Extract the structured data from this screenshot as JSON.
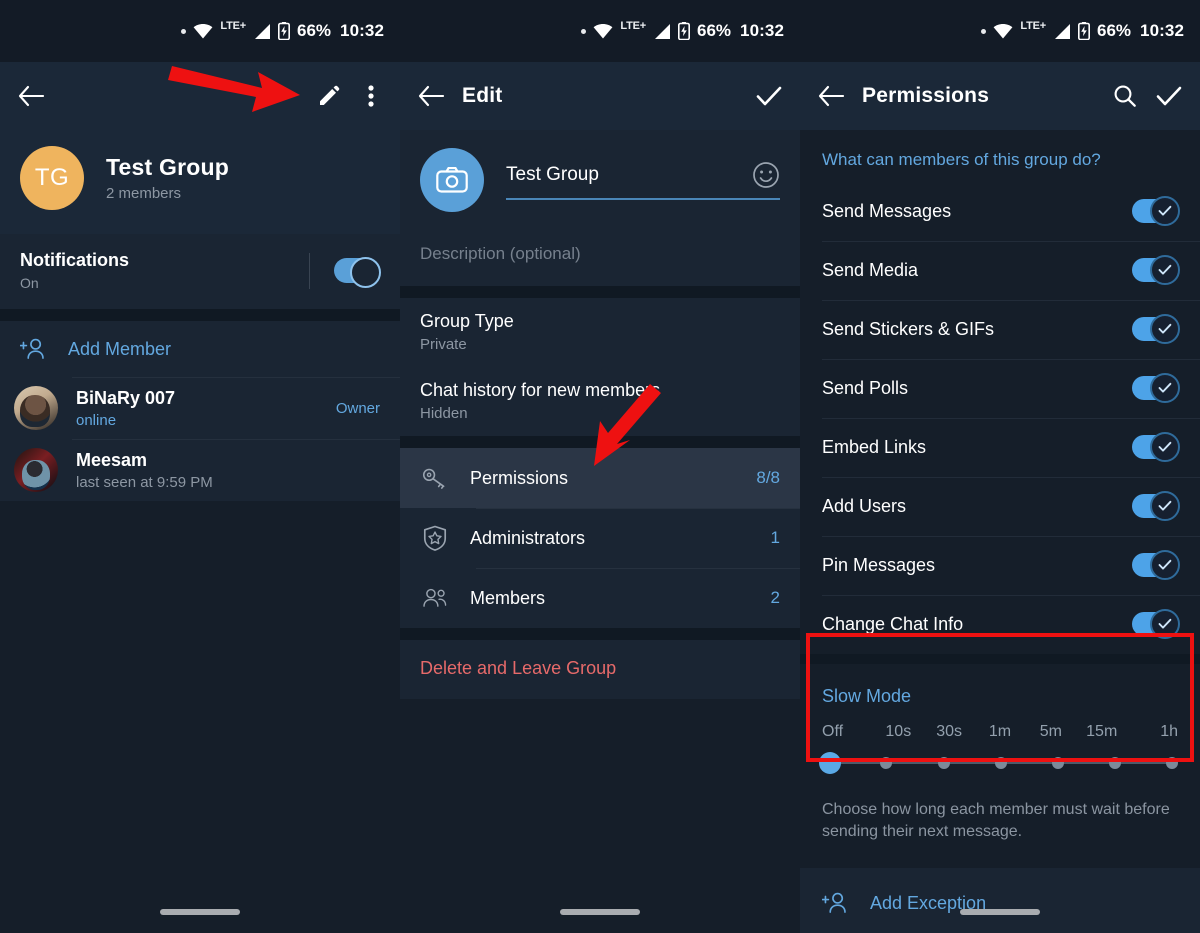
{
  "status_bar": {
    "lte": "LTE+",
    "battery": "66%",
    "time": "10:32"
  },
  "screen1": {
    "appbar": {
      "back_icon": "back-arrow-icon",
      "edit_icon": "pencil-icon",
      "more_icon": "overflow-menu-icon"
    },
    "profile": {
      "initials": "TG",
      "name": "Test Group",
      "members": "2 members"
    },
    "notifications": {
      "title": "Notifications",
      "value": "On",
      "toggle_on": true
    },
    "add_member_label": "Add Member",
    "members": [
      {
        "name": "BiNaRy 007",
        "status": "online",
        "status_online": true,
        "role": "Owner"
      },
      {
        "name": "Meesam",
        "status": "last seen at 9:59 PM",
        "status_online": false,
        "role": ""
      }
    ]
  },
  "screen2": {
    "appbar": {
      "title": "Edit",
      "back_icon": "back-arrow-icon",
      "done_icon": "check-icon"
    },
    "group_name": "Test Group",
    "description_placeholder": "Description (optional)",
    "rows": [
      {
        "label": "Group Type",
        "value": "Private"
      },
      {
        "label": "Chat history for new members",
        "value": "Hidden"
      }
    ],
    "nav": [
      {
        "icon": "key-icon",
        "label": "Permissions",
        "value": "8/8",
        "selected": true
      },
      {
        "icon": "shield-star-icon",
        "label": "Administrators",
        "value": "1",
        "selected": false
      },
      {
        "icon": "members-icon",
        "label": "Members",
        "value": "2",
        "selected": false
      }
    ],
    "delete_label": "Delete and Leave Group"
  },
  "screen3": {
    "appbar": {
      "title": "Permissions",
      "back_icon": "back-arrow-icon",
      "search_icon": "search-icon",
      "done_icon": "check-icon"
    },
    "section_header": "What can members of this group do?",
    "permissions": [
      {
        "label": "Send Messages",
        "on": true
      },
      {
        "label": "Send Media",
        "on": true
      },
      {
        "label": "Send Stickers & GIFs",
        "on": true
      },
      {
        "label": "Send Polls",
        "on": true
      },
      {
        "label": "Embed Links",
        "on": true
      },
      {
        "label": "Add Users",
        "on": true
      },
      {
        "label": "Pin Messages",
        "on": true
      },
      {
        "label": "Change Chat Info",
        "on": true
      }
    ],
    "slow_mode": {
      "title": "Slow Mode",
      "options": [
        "Off",
        "10s",
        "30s",
        "1m",
        "5m",
        "15m",
        "1h"
      ],
      "selected_index": 0,
      "description": "Choose how long each member must wait before sending their next message."
    },
    "add_exception_label": "Add Exception"
  },
  "annotations": {
    "highlight_color": "#ee1111",
    "arrow1_target": "pencil-icon",
    "arrow2_target": "permissions-row"
  }
}
